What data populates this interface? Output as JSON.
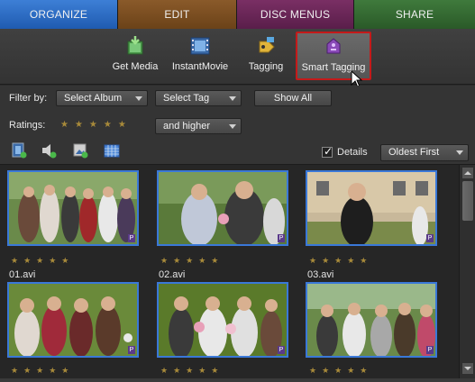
{
  "tabs": [
    {
      "label": "ORGANIZE",
      "active": true,
      "color": "#2f6fc7"
    },
    {
      "label": "EDIT",
      "active": false,
      "color": "#7a4e22"
    },
    {
      "label": "DISC MENUS",
      "active": false,
      "color": "#6a2757"
    },
    {
      "label": "SHARE",
      "active": false,
      "color": "#356a33"
    }
  ],
  "toolbar": {
    "get_media": "Get Media",
    "instant_movie": "InstantMovie",
    "tagging": "Tagging",
    "smart_tagging": "Smart Tagging"
  },
  "filters": {
    "filter_by_label": "Filter by:",
    "album_select": "Select Album",
    "tag_select": "Select Tag",
    "show_all": "Show All",
    "ratings_label": "Ratings:",
    "rating_mode": "and higher",
    "rating_stars": "★★★★★"
  },
  "view": {
    "details_label": "Details",
    "details_checked": true,
    "sort": "Oldest First"
  },
  "clips": [
    {
      "name": "01.avi",
      "stars": "★★★★★"
    },
    {
      "name": "02.avi",
      "stars": "★★★★★"
    },
    {
      "name": "03.avi",
      "stars": "★★★★★"
    },
    {
      "name": "",
      "stars": "★★★★★"
    },
    {
      "name": "",
      "stars": "★★★★★"
    },
    {
      "name": "",
      "stars": "★★★★★"
    }
  ],
  "badge": "P",
  "icons": {
    "get_media": "film-download-icon",
    "instant_movie": "film-strip-icon",
    "tagging": "tag-icon",
    "smart_tagging": "smart-tag-icon"
  }
}
